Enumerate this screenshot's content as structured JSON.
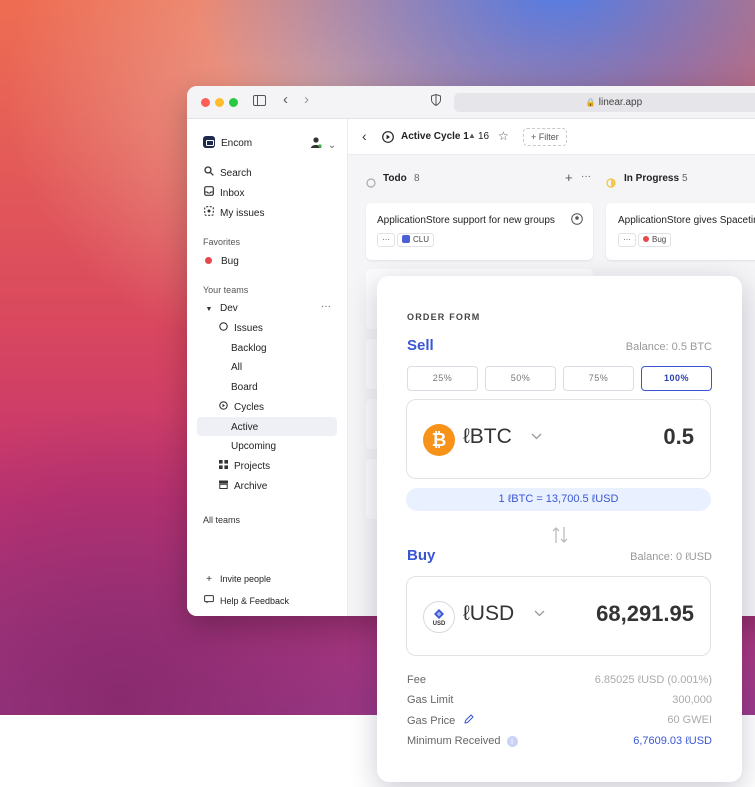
{
  "browser": {
    "url": "linear.app"
  },
  "sidebar": {
    "workspace": "Encom",
    "nav": [
      {
        "label": "Search",
        "icon": "search-icon"
      },
      {
        "label": "Inbox",
        "icon": "inbox-icon"
      },
      {
        "label": "My issues",
        "icon": "my-issues-icon"
      }
    ],
    "favorites_heading": "Favorites",
    "favorites": [
      {
        "label": "Bug",
        "color": "#e5484d"
      }
    ],
    "teams_heading": "Your teams",
    "team": "Dev",
    "team_items": [
      {
        "label": "Issues",
        "icon": "circle-icon"
      },
      {
        "label": "Backlog"
      },
      {
        "label": "All"
      },
      {
        "label": "Board"
      },
      {
        "label": "Cycles",
        "icon": "cycle-icon"
      },
      {
        "label": "Active",
        "active": true
      },
      {
        "label": "Upcoming"
      },
      {
        "label": "Projects",
        "icon": "grid-icon"
      },
      {
        "label": "Archive",
        "icon": "archive-icon"
      }
    ],
    "all_teams": "All teams",
    "invite": "Invite people",
    "help": "Help & Feedback"
  },
  "header": {
    "title": "Active Cycle 1",
    "count": "16",
    "filter": "+ Filter"
  },
  "board": {
    "columns": [
      {
        "title": "Todo",
        "count": "8"
      },
      {
        "title": "In Progress",
        "count": "5"
      }
    ],
    "cards": [
      {
        "title": "ApplicationStore support for new groups",
        "tag": "CLU"
      },
      {
        "title": "ApplicationStore gives Spacetim",
        "tag": "Bug"
      }
    ]
  },
  "order_form": {
    "heading": "ORDER FORM",
    "sell": {
      "label": "Sell",
      "balance": "Balance: 0.5 BTC",
      "percentages": [
        "25%",
        "50%",
        "75%",
        "100%"
      ],
      "selected_percentage": "100%",
      "token": "ℓBTC",
      "amount": "0.5"
    },
    "rate": "1 ℓBTC = 13,700.5 ℓUSD",
    "buy": {
      "label": "Buy",
      "balance": "Balance: 0 ℓUSD",
      "token": "ℓUSD",
      "coin_text": "USD",
      "amount": "68,291.95"
    },
    "fees": [
      {
        "label": "Fee",
        "value": "6.85025 ℓUSD (0.001%)"
      },
      {
        "label": "Gas Limit",
        "value": "300,000"
      },
      {
        "label": "Gas Price",
        "value": "60 GWEI"
      },
      {
        "label": "Minimum Received",
        "value": "6,7609.03 ℓUSD"
      }
    ],
    "accent_color": "#3a56d4"
  }
}
